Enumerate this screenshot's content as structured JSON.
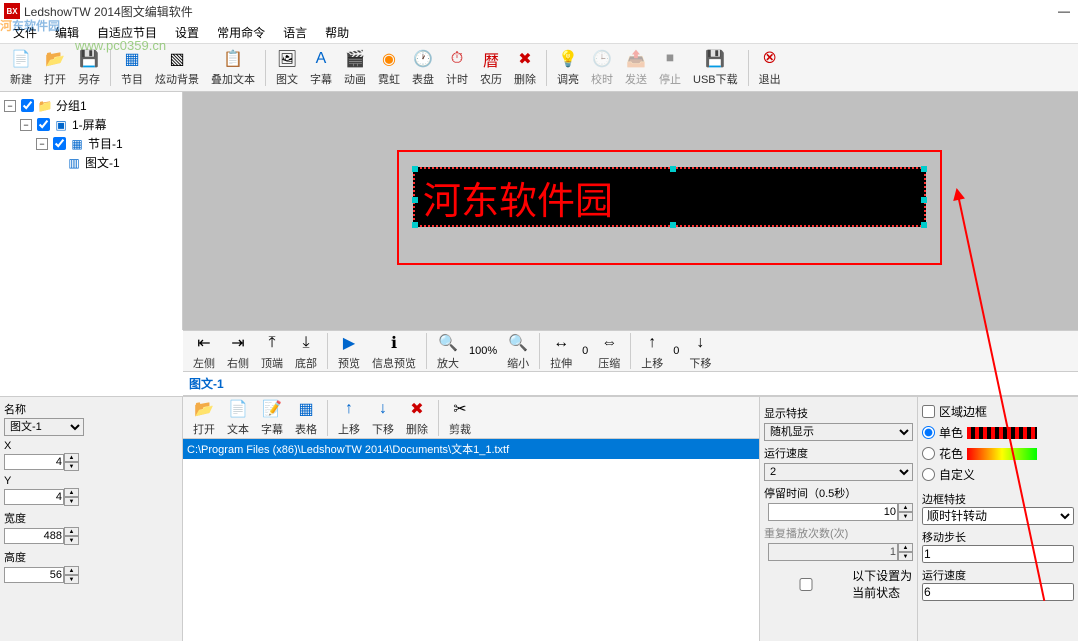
{
  "titlebar": {
    "title": "LedshowTW 2014图文编辑软件",
    "icon_text": "BX"
  },
  "watermark": {
    "main_1": "河",
    "main_2": "东软件园",
    "sub": "www.pc0359.cn"
  },
  "menu": {
    "items": [
      "文件",
      "编辑",
      "自适应节目",
      "设置",
      "常用命令",
      "语言",
      "帮助"
    ]
  },
  "toolbar_main": [
    {
      "label": "新建",
      "icon": "📄"
    },
    {
      "label": "打开",
      "icon": "📂"
    },
    {
      "label": "另存",
      "icon": "💾"
    },
    {
      "label": "节目",
      "icon": "🟦"
    },
    {
      "label": "炫动背景",
      "icon": "🔳"
    },
    {
      "label": "叠加文本",
      "icon": "📋"
    },
    {
      "label": "图文",
      "icon": "🖼"
    },
    {
      "label": "字幕",
      "icon": "🔤"
    },
    {
      "label": "动画",
      "icon": "🎬"
    },
    {
      "label": "霓虹",
      "icon": "🌈"
    },
    {
      "label": "表盘",
      "icon": "🕐"
    },
    {
      "label": "计时",
      "icon": "⏱"
    },
    {
      "label": "农历",
      "icon": "📅"
    },
    {
      "label": "删除",
      "icon": "✖"
    },
    {
      "label": "调亮",
      "icon": "💡"
    },
    {
      "label": "校时",
      "icon": "🕒",
      "disabled": true
    },
    {
      "label": "发送",
      "icon": "📤",
      "disabled": true
    },
    {
      "label": "停止",
      "icon": "⏹",
      "disabled": true
    },
    {
      "label": "USB下载",
      "icon": "💾"
    },
    {
      "label": "退出",
      "icon": "🚪"
    }
  ],
  "tree": {
    "n0": {
      "label": "分组1",
      "icon": "📁"
    },
    "n1": {
      "label": "1-屏幕",
      "icon": "🖥"
    },
    "n2": {
      "label": "节目-1",
      "icon": "📋"
    },
    "n3": {
      "label": "图文-1",
      "icon": "🔲"
    }
  },
  "canvas": {
    "led_text": "河东软件园"
  },
  "mid_toolbar": {
    "items": [
      "左侧",
      "右侧",
      "顶端",
      "底部",
      "预览",
      "信息预览",
      "放大",
      "缩小",
      "拉伸",
      "压缩",
      "上移",
      "下移"
    ],
    "zoom_pct": "100%",
    "stretch_val": "0",
    "move_val": "0"
  },
  "section_title": "图文-1",
  "props": {
    "name_label": "名称",
    "name_value": "图文-1",
    "x_label": "X",
    "x_value": "4",
    "y_label": "Y",
    "y_value": "4",
    "w_label": "宽度",
    "w_value": "488",
    "h_label": "高度",
    "h_value": "56"
  },
  "file_toolbar": {
    "items": [
      {
        "label": "打开",
        "icon": "📂"
      },
      {
        "label": "文本",
        "icon": "📄"
      },
      {
        "label": "字幕",
        "icon": "📝"
      },
      {
        "label": "表格",
        "icon": "📊"
      },
      {
        "label": "上移",
        "icon": "↑"
      },
      {
        "label": "下移",
        "icon": "↓"
      },
      {
        "label": "删除",
        "icon": "✖"
      },
      {
        "label": "剪裁",
        "icon": "✂"
      }
    ]
  },
  "file_list": {
    "item0": "C:\\Program Files (x86)\\LedshowTW 2014\\Documents\\文本1_1.txtf"
  },
  "effects": {
    "display_label": "显示特技",
    "display_value": "随机显示",
    "speed_label": "运行速度",
    "speed_value": "2",
    "stay_label": "停留时间（0.5秒）",
    "stay_value": "10",
    "repeat_label": "重复播放次数(次)",
    "repeat_value": "1",
    "default_chk_label": "以下设置为当前状态"
  },
  "border": {
    "group_label": "区域边框",
    "r_single": "单色",
    "r_flower": "花色",
    "r_custom": "自定义",
    "effect_label": "边框特技",
    "effect_value": "顺时针转动",
    "step_label": "移动步长",
    "step_value": "1",
    "speed_label": "运行速度",
    "speed_value": "6"
  }
}
